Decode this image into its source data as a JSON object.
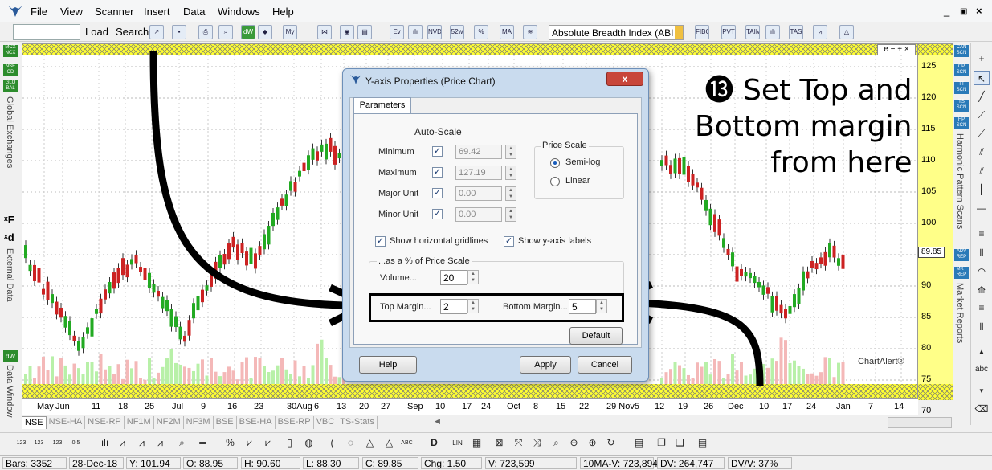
{
  "menu": {
    "items": [
      "File",
      "View",
      "Scanner",
      "Insert",
      "Data",
      "Windows",
      "Help"
    ]
  },
  "toolbar": {
    "load_label": "Load",
    "search_label": "Search",
    "indicator_value": "Absolute Breadth Index (ABI"
  },
  "left_panel": {
    "badges": [
      "MCX NCX",
      "NSE CD",
      "GLO BAL"
    ],
    "global_exchanges_label": "Global Exchanges",
    "external_data_label": "External Data",
    "data_window_label": "Data Window",
    "dw_label": "dW"
  },
  "right_panel": {
    "badges": [
      "CAN SCN",
      "CP SCN",
      "TT SCN",
      "TS SCN",
      "HP SCN"
    ],
    "harmonic_label": "Harmonic Pattern Scans",
    "report_badges": [
      "ADV REP",
      "MKT REP"
    ],
    "market_reports_label": "Market Reports"
  },
  "chart": {
    "controls": "e − + ×",
    "y_ticks": [
      "125",
      "120",
      "115",
      "110",
      "105",
      "100",
      "95",
      "90",
      "85",
      "80",
      "75",
      "70"
    ],
    "x_ticks": [
      "May",
      "Jun",
      "11",
      "18",
      "25",
      "Jul",
      "9",
      "16",
      "23",
      "30Aug",
      "6",
      "13",
      "20",
      "27",
      "Sep",
      "10",
      "17",
      "24",
      "Oct",
      "8",
      "15",
      "22",
      "29 Nov5",
      "12",
      "19",
      "26",
      "Dec",
      "10",
      "17",
      "24",
      "Jan",
      "7",
      "14"
    ],
    "last_price": "89.85",
    "watermark": "ChartAlert®"
  },
  "annotation": {
    "number": "⓭",
    "lines": [
      "Set Top and",
      "Bottom margin",
      "from here"
    ]
  },
  "dialog": {
    "title": "Y-axis Properties (Price Chart)",
    "close": "x",
    "tab": "Parameters",
    "auto_scale_label": "Auto-Scale",
    "rows": [
      {
        "label": "Minimum",
        "value": "69.42"
      },
      {
        "label": "Maximum",
        "value": "127.19"
      },
      {
        "label": "Major Unit",
        "value": "0.00"
      },
      {
        "label": "Minor Unit",
        "value": "0.00"
      }
    ],
    "price_scale_label": "Price Scale",
    "semilog_label": "Semi-log",
    "linear_label": "Linear",
    "show_gridlines_label": "Show horizontal gridlines",
    "show_ylabels_label": "Show y-axis labels",
    "pct_label": "...as a % of Price Scale",
    "volume_label": "Volume...",
    "volume_value": "20",
    "top_margin_label": "Top Margin...",
    "top_margin_value": "2",
    "bottom_margin_label": "Bottom Margin...",
    "bottom_margin_value": "5",
    "default_button": "Default",
    "help_button": "Help",
    "apply_button": "Apply",
    "cancel_button": "Cancel"
  },
  "tabs": [
    "NSE",
    "NSE-HA",
    "NSE-RP",
    "NF1M",
    "NF2M",
    "NF3M",
    "BSE",
    "BSE-HA",
    "BSE-RP",
    "VBC",
    "TS-Stats"
  ],
  "status": [
    "Bars: 3352",
    "28-Dec-18",
    "Y: 101.94",
    "O: 88.95",
    "H: 90.60",
    "L: 88.30",
    "C: 89.85",
    "Chg: 1.50",
    "V: 723,599",
    "10MA-V: 723,894",
    "DV: 264,747",
    "DV/V: 37%"
  ],
  "colors": {
    "up_candle": "#22aa22",
    "down_candle": "#cc2222",
    "hatch": "#ffff33",
    "axis_bg": "#ffff88"
  }
}
